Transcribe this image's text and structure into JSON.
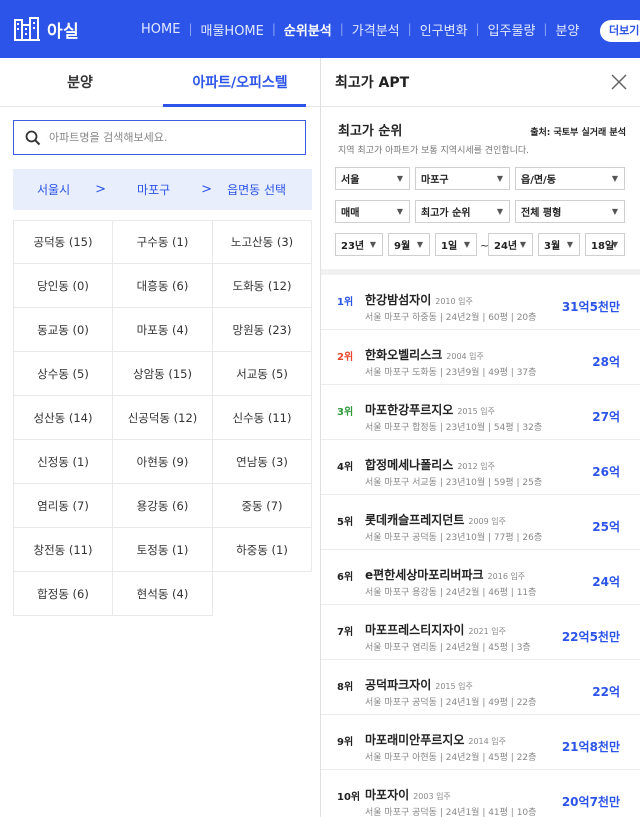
{
  "header": {
    "logo_text": "아실",
    "nav": [
      {
        "label": "HOME",
        "active": false
      },
      {
        "label": "매물HOME",
        "active": false
      },
      {
        "label": "순위분석",
        "active": true
      },
      {
        "label": "가격분석",
        "active": false
      },
      {
        "label": "인구변화",
        "active": false
      },
      {
        "label": "입주물량",
        "active": false
      },
      {
        "label": "분양",
        "active": false
      }
    ],
    "more_label": "더보기"
  },
  "left": {
    "tabs": [
      {
        "label": "분양",
        "active": false
      },
      {
        "label": "아파트/오피스텔",
        "active": true
      }
    ],
    "search_placeholder": "아파트명을 검색해보세요.",
    "breadcrumb": {
      "city": "서울시",
      "district": "마포구",
      "select": "읍면동 선택",
      "sep": ">"
    },
    "dongs": [
      "공덕동 (15)",
      "구수동 (1)",
      "노고산동 (3)",
      "당인동 (0)",
      "대흥동 (6)",
      "도화동 (12)",
      "동교동 (0)",
      "마포동 (4)",
      "망원동 (23)",
      "상수동 (5)",
      "상암동 (15)",
      "서교동 (5)",
      "성산동 (14)",
      "신공덕동 (12)",
      "신수동 (11)",
      "신정동 (1)",
      "아현동 (9)",
      "연남동 (3)",
      "염리동 (7)",
      "용강동 (6)",
      "중동 (7)",
      "창전동 (11)",
      "토정동 (1)",
      "하중동 (1)",
      "합정동 (6)",
      "현석동 (4)"
    ]
  },
  "right": {
    "title": "최고가 APT",
    "section_title": "최고가 순위",
    "source": "출처: 국토부 실거래 분석",
    "description": "지역 최고가 아파트가 보통 지역시세를 견인합니다.",
    "filters_row1": [
      "서울",
      "마포구",
      "읍/면/동"
    ],
    "filters_row2": [
      "매매",
      "최고가 순위",
      "전체 평형"
    ],
    "date_from": [
      "23년",
      "9월",
      "1일"
    ],
    "date_tilde": "~",
    "date_to": [
      "24년",
      "3월",
      "18일"
    ],
    "arrow": "▼",
    "ranks": [
      {
        "rank": "1위",
        "name": "한강밤섬자이",
        "year": "2010 입주",
        "info": "서울 마포구 하중동 | 24년2월 | 60평 | 20층",
        "price": "31억5천만",
        "color": "#2c54e8"
      },
      {
        "rank": "2위",
        "name": "한화오벨리스크",
        "year": "2004 입주",
        "info": "서울 마포구 도화동 | 23년9월 | 49평 | 37층",
        "price": "28억",
        "color": "#e8462c"
      },
      {
        "rank": "3위",
        "name": "마포한강푸르지오",
        "year": "2015 입주",
        "info": "서울 마포구 합정동 | 23년10월 | 54평 | 32층",
        "price": "27억",
        "color": "#2e9a3a"
      },
      {
        "rank": "4위",
        "name": "합정메세나폴리스",
        "year": "2012 입주",
        "info": "서울 마포구 서교동 | 23년10월 | 59평 | 25층",
        "price": "26억",
        "color": "#222222"
      },
      {
        "rank": "5위",
        "name": "롯데캐슬프레지던트",
        "year": "2009 입주",
        "info": "서울 마포구 공덕동 | 23년10월 | 77평 | 26층",
        "price": "25억",
        "color": "#222222"
      },
      {
        "rank": "6위",
        "name": "e편한세상마포리버파크",
        "year": "2016 입주",
        "info": "서울 마포구 용강동 | 24년2월 | 46평 | 11층",
        "price": "24억",
        "color": "#222222"
      },
      {
        "rank": "7위",
        "name": "마포프레스티지자이",
        "year": "2021 입주",
        "info": "서울 마포구 염리동 | 24년2월 | 45평 | 3층",
        "price": "22억5천만",
        "color": "#222222"
      },
      {
        "rank": "8위",
        "name": "공덕파크자이",
        "year": "2015 입주",
        "info": "서울 마포구 공덕동 | 24년1월 | 49평 | 22층",
        "price": "22억",
        "color": "#222222"
      },
      {
        "rank": "9위",
        "name": "마포래미안푸르지오",
        "year": "2014 입주",
        "info": "서울 마포구 아현동 | 24년2월 | 45평 | 22층",
        "price": "21억8천만",
        "color": "#222222"
      },
      {
        "rank": "10위",
        "name": "마포자이",
        "year": "2003 입주",
        "info": "서울 마포구 공덕동 | 24년1월 | 41평 | 10층",
        "price": "20억7천만",
        "color": "#222222"
      }
    ]
  },
  "colors": {
    "brand": "#2c54e8",
    "rank1": "#2c54e8",
    "rank2": "#e8462c",
    "rank3": "#2e9a3a"
  }
}
